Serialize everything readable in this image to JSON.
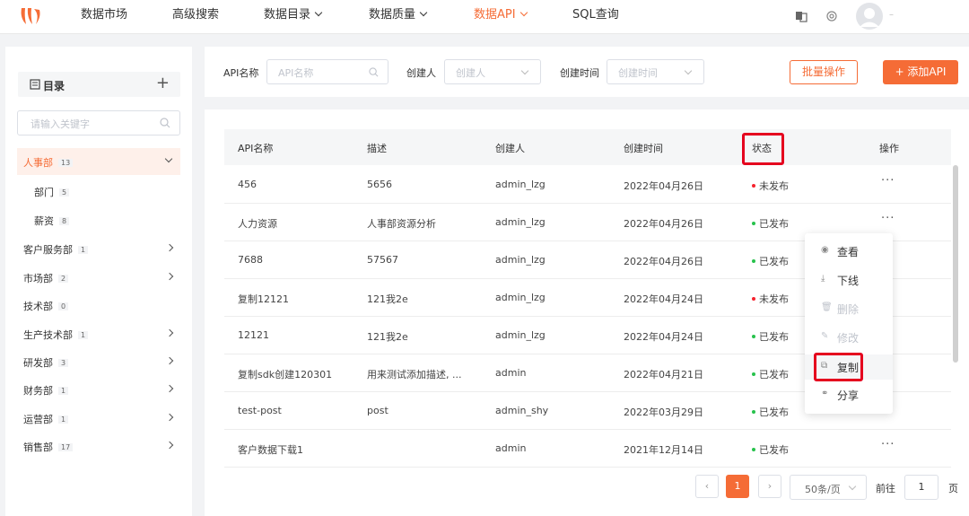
{
  "nav": {
    "items": [
      {
        "label": "数据市场"
      },
      {
        "label": "高级搜索"
      },
      {
        "label": "数据目录"
      },
      {
        "label": "数据质量"
      },
      {
        "label": "数据API"
      },
      {
        "label": "SQL查询"
      }
    ],
    "active": "数据API",
    "username": "–"
  },
  "sidebar": {
    "title": "目录",
    "search_placeholder": "请输入关键字",
    "departments": [
      {
        "name": "人事部",
        "count": "13",
        "expanded": true,
        "active": true
      },
      {
        "name": "部门",
        "count": "5",
        "child": true
      },
      {
        "name": "薪资",
        "count": "8",
        "child": true
      },
      {
        "name": "客户服务部",
        "count": "1"
      },
      {
        "name": "市场部",
        "count": "2"
      },
      {
        "name": "技术部",
        "count": "0"
      },
      {
        "name": "生产技术部",
        "count": "1"
      },
      {
        "name": "研发部",
        "count": "3"
      },
      {
        "name": "财务部",
        "count": "1"
      },
      {
        "name": "运营部",
        "count": "1"
      },
      {
        "name": "销售部",
        "count": "17"
      }
    ]
  },
  "filters": {
    "api_name_label": "API名称",
    "api_name_placeholder": "API名称",
    "creator_label": "创建人",
    "creator_placeholder": "创建人",
    "created_time_label": "创建时间",
    "created_time_placeholder": "创建时间",
    "batch_button": "批量操作",
    "add_button": "+ 添加API"
  },
  "table": {
    "headers": [
      "API名称",
      "描述",
      "创建人",
      "创建时间",
      "状态",
      "操作"
    ],
    "rows": [
      {
        "name": "456",
        "desc": "5656",
        "creator": "admin_lzg",
        "time": "2022年04月26日",
        "status": "未发布",
        "published": false
      },
      {
        "name": "人力资源",
        "desc": "人事部资源分析",
        "creator": "admin_lzg",
        "time": "2022年04月26日",
        "status": "已发布",
        "published": true
      },
      {
        "name": "7688",
        "desc": "57567",
        "creator": "admin_lzg",
        "time": "2022年04月26日",
        "status": "已发布",
        "published": true
      },
      {
        "name": "复制12121",
        "desc": "121我2e",
        "creator": "admin_lzg",
        "time": "2022年04月24日",
        "status": "未发布",
        "published": false
      },
      {
        "name": "12121",
        "desc": "121我2e",
        "creator": "admin_lzg",
        "time": "2022年04月24日",
        "status": "已发布",
        "published": true
      },
      {
        "name": "复制sdk创建120301",
        "desc": "用来测试添加描述, ...",
        "creator": "admin",
        "time": "2022年04月21日",
        "status": "已发布",
        "published": true
      },
      {
        "name": "test-post",
        "desc": "post",
        "creator": "admin_shy",
        "time": "2022年03月29日",
        "status": "已发布",
        "published": true
      },
      {
        "name": "客户数据下载1",
        "desc": "",
        "creator": "admin",
        "time": "2021年12月14日",
        "status": "已发布",
        "published": true
      }
    ],
    "more_label": "···"
  },
  "dropdown": {
    "items": [
      {
        "label": "查看",
        "icon": "eye-icon",
        "disabled": false
      },
      {
        "label": "下线",
        "icon": "offline-icon",
        "disabled": false
      },
      {
        "label": "删除",
        "icon": "trash-icon",
        "disabled": true
      },
      {
        "label": "修改",
        "icon": "edit-icon",
        "disabled": true
      },
      {
        "label": "复制",
        "icon": "copy-icon",
        "disabled": false
      },
      {
        "label": "分享",
        "icon": "share-icon",
        "disabled": false
      }
    ]
  },
  "pagination": {
    "prev": "‹",
    "current": "1",
    "next": "›",
    "page_size": "50条/页",
    "goto_label": "前往",
    "goto_value": "1",
    "page_suffix": "页"
  },
  "colors": {
    "accent": "#f56c36",
    "published": "#27c24c",
    "unpublished": "#f5222d",
    "highlight": "#e5001e"
  }
}
